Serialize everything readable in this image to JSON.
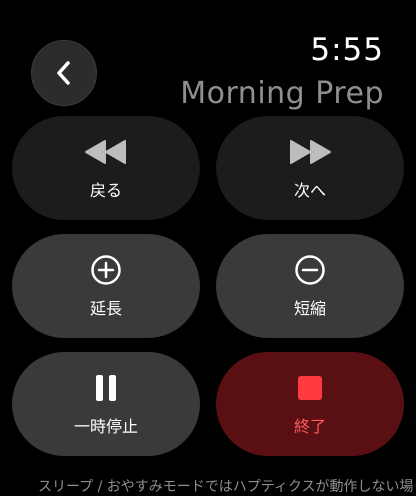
{
  "status": {
    "time": "5:55"
  },
  "session": {
    "title": "Morning Prep"
  },
  "controls": {
    "back": {
      "label": "戻る",
      "icon": "rewind-icon"
    },
    "next": {
      "label": "次へ",
      "icon": "fast-forward-icon"
    },
    "extend": {
      "label": "延長",
      "icon": "plus-circle-icon"
    },
    "shorten": {
      "label": "短縮",
      "icon": "minus-circle-icon"
    },
    "pause": {
      "label": "一時停止",
      "icon": "pause-icon"
    },
    "end": {
      "label": "終了",
      "icon": "stop-icon"
    }
  },
  "footnote": "スリープ / おやすみモードではハプティクスが動作しない場",
  "colors": {
    "end_accent": "#ff3b3f",
    "end_bg": "#5a1013",
    "title_gray": "#8e8e93"
  }
}
